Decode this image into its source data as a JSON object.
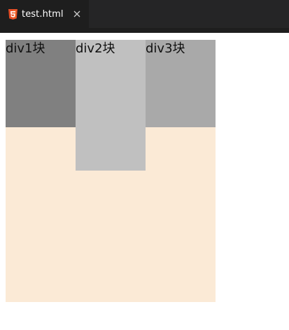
{
  "editor": {
    "tab": {
      "icon": "html5-icon",
      "label": "test.html",
      "close_icon": "close-icon"
    },
    "colors": {
      "tabbar_bg": "#252526",
      "active_tab_bg": "#1e1e1e",
      "html5_icon": "#e44d26"
    }
  },
  "page": {
    "container_color": "#fbead6",
    "blocks": [
      {
        "label": "div1块",
        "color": "#808080"
      },
      {
        "label": "div2块",
        "color": "#c0c0c0"
      },
      {
        "label": "div3块",
        "color": "#a9a9a9"
      }
    ]
  }
}
